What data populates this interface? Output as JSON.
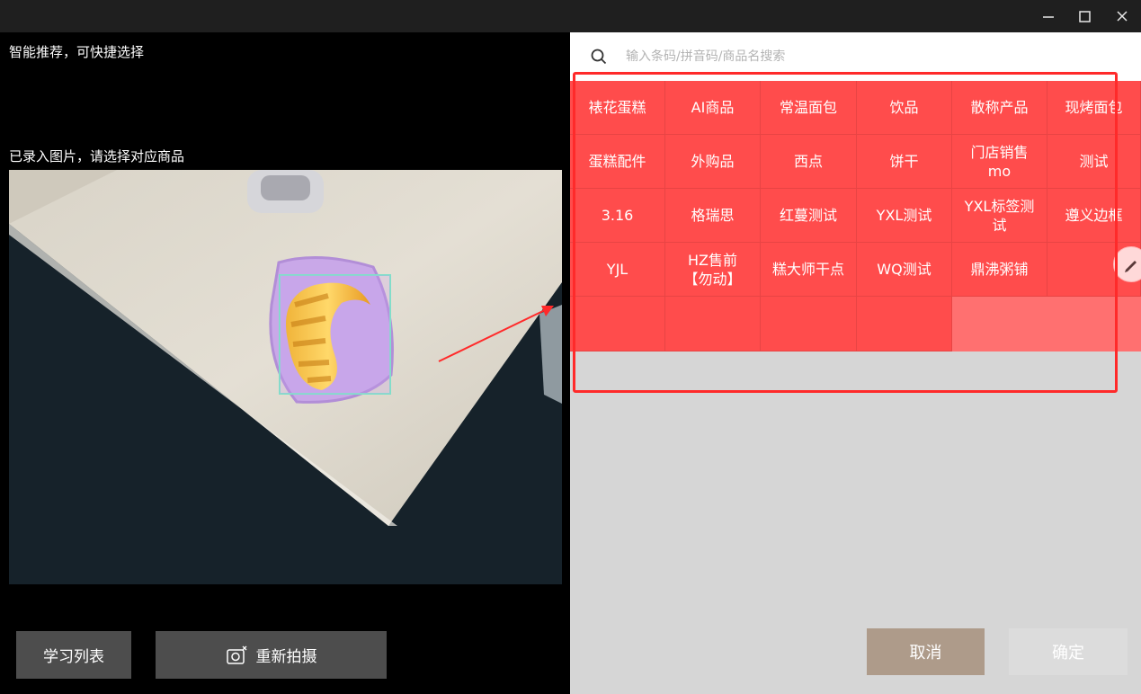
{
  "left": {
    "smart_caption": "智能推荐，可快捷选择",
    "recorded_caption": "已录入图片，请选择对应商品",
    "learn_list_label": "学习列表",
    "retake_label": "重新拍摄"
  },
  "search": {
    "placeholder": "输入条码/拼音码/商品名搜索"
  },
  "categories": [
    "裱花蛋糕",
    "AI商品",
    "常温面包",
    "饮品",
    "散称产品",
    "现烤面包",
    "蛋糕配件",
    "外购品",
    "西点",
    "饼干",
    "门店销售\nmo",
    "测试",
    "3.16",
    "格瑞思",
    "红蔓测试",
    "YXL测试",
    "YXL标签测\n试",
    "遵义边框",
    "YJL",
    "HZ售前\n【勿动】",
    "糕大师干点",
    "WQ测试",
    "鼎沸粥铺"
  ],
  "footer": {
    "cancel_label": "取消",
    "confirm_label": "确定"
  },
  "colors": {
    "grid_red": "#ff4c4c",
    "grid_pink": "#ff7070",
    "cancel_bg": "#ae9b8a",
    "confirm_bg": "#dcdcdc",
    "highlight": "#ff2a2a"
  },
  "icons": [
    "minimize-icon",
    "maximize-icon",
    "close-icon",
    "search-icon",
    "camera-icon",
    "pencil-icon",
    "annotation-arrow"
  ]
}
